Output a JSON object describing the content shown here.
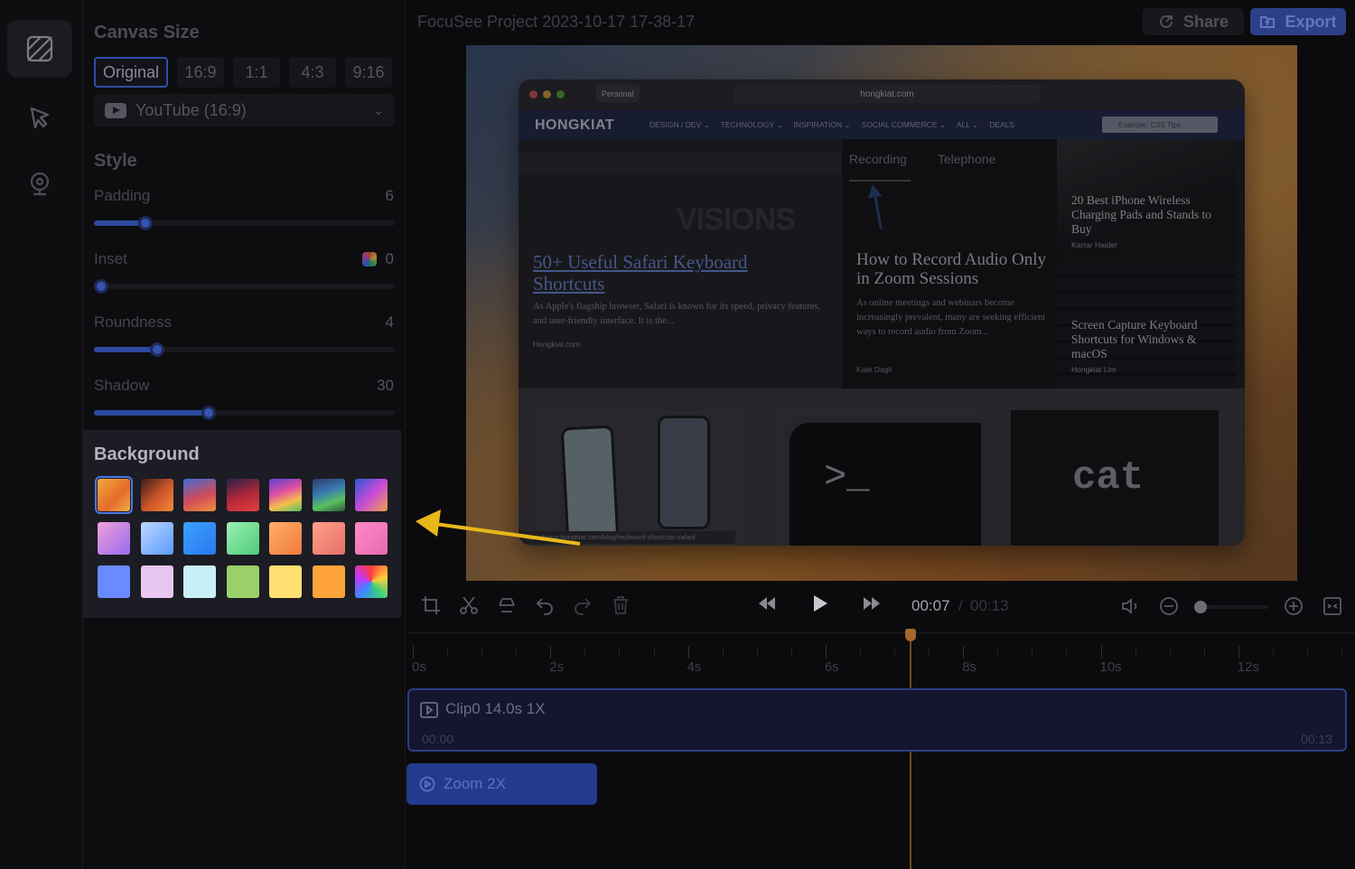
{
  "project": {
    "title": "FocuSee Project 2023-10-17 17-38-17"
  },
  "header": {
    "share_label": "Share",
    "export_label": "Export"
  },
  "canvas": {
    "title": "Canvas Size",
    "ratios": [
      "Original",
      "16:9",
      "1:1",
      "4:3",
      "9:16"
    ],
    "selected_ratio": "Original",
    "preset": "YouTube (16:9)"
  },
  "style": {
    "title": "Style",
    "padding": {
      "label": "Padding",
      "value": "6",
      "level": 0.17
    },
    "inset": {
      "label": "Inset",
      "value": "0",
      "level": 0.0
    },
    "roundness": {
      "label": "Roundness",
      "value": "4",
      "level": 0.21
    },
    "shadow": {
      "label": "Shadow",
      "value": "30",
      "level": 0.38
    }
  },
  "background": {
    "title": "Background",
    "selected_index": 0,
    "swatches": [
      "linear-gradient(135deg,#f2a93b,#e56a2a 60%,#f0b24a)",
      "linear-gradient(135deg,#3a1f1a,#d2572a 55%,#f08a3a)",
      "linear-gradient(160deg,#3b6fd6,#d14a5a 55%,#f0903a)",
      "linear-gradient(160deg,#2a2248,#b5283a 55%,#e2403a)",
      "linear-gradient(160deg,#5a3fd6,#e04ea0 40%,#f5c04a 70%,#4ec06a)",
      "linear-gradient(160deg,#2a3a6a,#3a7ab0 40%,#5ac060 70%,#2a5a3a)",
      "linear-gradient(135deg,#2a5ad6,#c64ad8 50%,#f0a04a)",
      "linear-gradient(135deg,#f0a0d8,#9a6af0)",
      "linear-gradient(135deg,#bcd8ff,#5a9aff)",
      "linear-gradient(135deg,#3aa0ff,#2a78f0)",
      "linear-gradient(135deg,#9af0b0,#4ecb7a)",
      "linear-gradient(135deg,#ffb06a,#f07a3a)",
      "linear-gradient(135deg,#ffa08a,#e8706a)",
      "linear-gradient(135deg,#ff8ac8,#e86ab0)",
      "#6a8aff",
      "#e8c6f2",
      "#c8f0f6",
      "#9ad06a",
      "#ffe070",
      "#ffa43a",
      "conic-gradient(#ff3a3a,#ffd03a,#3ad07a,#3a8aff,#c03aff,#ff3a3a)"
    ]
  },
  "preview": {
    "profile": "Personal",
    "url": "hongkiat.com",
    "logo": "HONGKIAT",
    "nav": [
      "DESIGN / DEV ⌄",
      "TECHNOLOGY ⌄",
      "INSPIRATION ⌄",
      "SOCIAL COMMERCE ⌄",
      "ALL ⌄",
      "DEALS"
    ],
    "search_placeholder": "Example: CSS Tips",
    "feature": {
      "title": "50+ Useful Safari Keyboard Shortcuts",
      "desc": "As Apple's flagship browser, Safari is known for its speed, privacy features, and user-friendly interface. It is the...",
      "source": "Hongkiat.com",
      "bg_text": "VISIONS"
    },
    "middle": {
      "tabs": [
        "Recording",
        "Telephone"
      ],
      "title": "How to Record Audio Only in Zoom Sessions",
      "desc": "As online meetings and webinars become increasingly prevalent, many are seeking efficient ways to record audio from Zoom...",
      "author": "Kate Dagli"
    },
    "right_cards": [
      {
        "title": "20 Best iPhone Wireless Charging Pads and Stands to Buy",
        "author": "Karrar Haider"
      },
      {
        "title": "Screen Capture Keyboard Shortcuts for Windows & macOS",
        "author": "Hongkiat Lim"
      }
    ],
    "thumbs": {
      "terminal": ">_",
      "cat": "cat"
    },
    "status_url": "https://www.hongkiat.com/blog/keyboard-shortcuts-safari/"
  },
  "playback": {
    "current": "00:07",
    "separator": "/",
    "total": "00:13"
  },
  "timeline": {
    "ticks": [
      "0s",
      "2s",
      "4s",
      "6s",
      "8s",
      "10s",
      "12s"
    ],
    "clip": {
      "title": "Clip0 14.0s 1X",
      "start": "00:00",
      "end": "00:13"
    },
    "zoom": {
      "label": "Zoom 2X"
    }
  }
}
